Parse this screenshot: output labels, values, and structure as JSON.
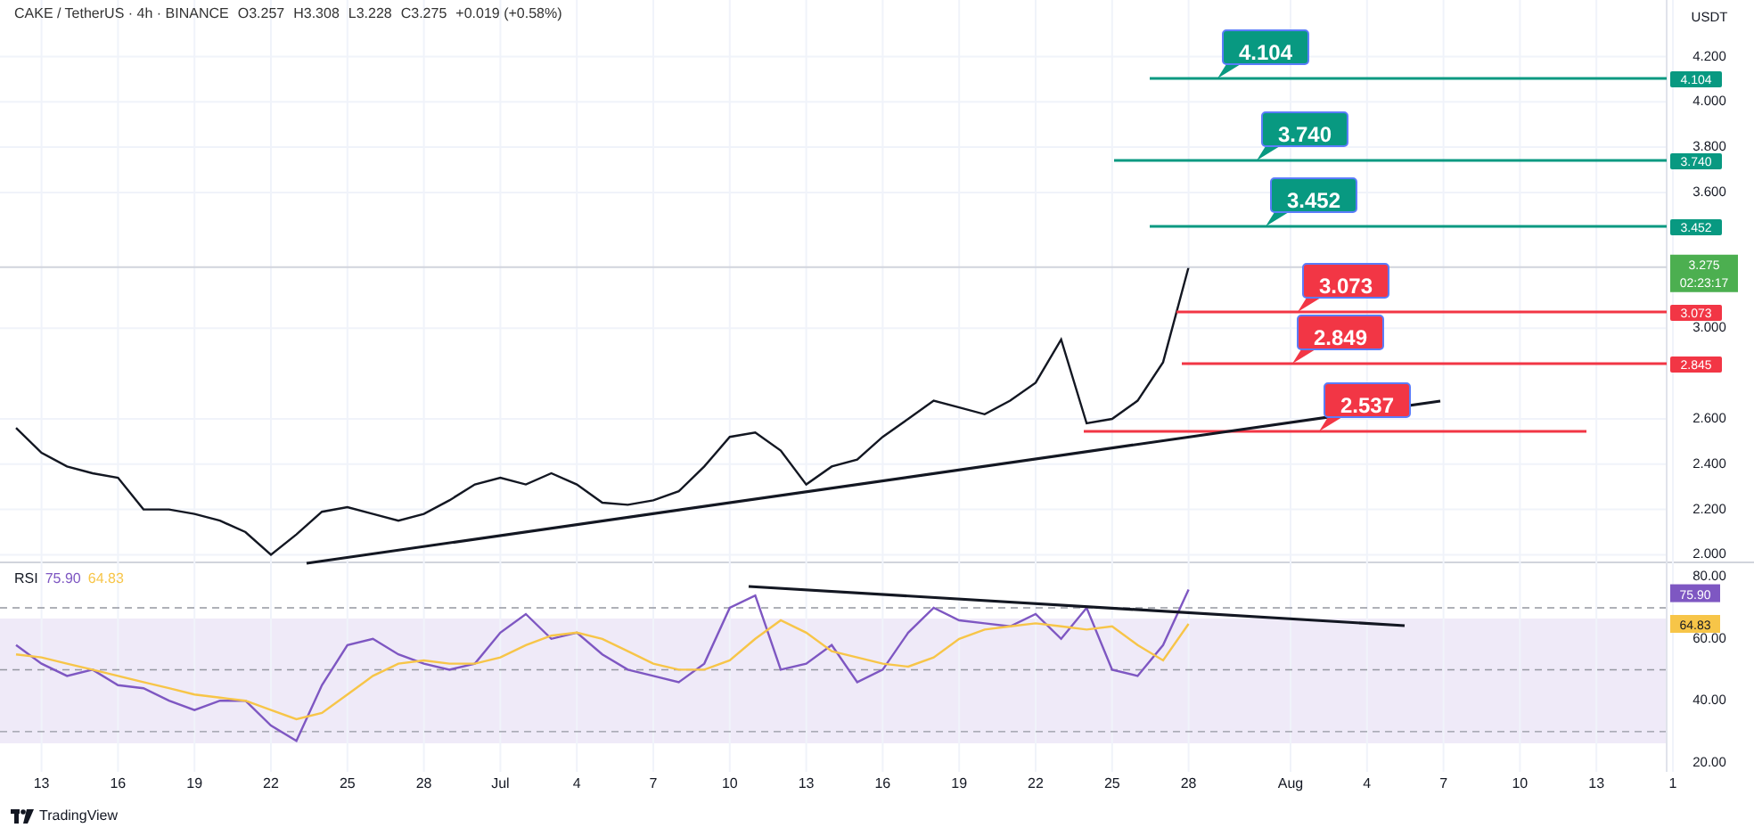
{
  "header": {
    "symbol": "CAKE / TetherUS · 4h · BINANCE",
    "ohlc": [
      "O3.257",
      "H3.308",
      "L3.228",
      "C3.275",
      "+0.019 (+0.58%)"
    ]
  },
  "price_axis": {
    "currency": "USDT",
    "last_price": "3.275",
    "countdown": "02:23:17"
  },
  "price_chart": {
    "levels": [
      {
        "kind": "resistance",
        "label": "4.104",
        "axis_label": "4.104"
      },
      {
        "kind": "resistance",
        "label": "3.740",
        "axis_label": "3.740"
      },
      {
        "kind": "resistance",
        "label": "3.452",
        "axis_label": "3.452"
      },
      {
        "kind": "support",
        "label": "3.073",
        "axis_label": "3.073"
      },
      {
        "kind": "support",
        "label": "2.849",
        "axis_label": "2.845"
      },
      {
        "kind": "support",
        "label": "2.537"
      }
    ],
    "chart_data": {
      "type": "line",
      "grid": true,
      "series": [
        {
          "color": "#131722",
          "values": [
            2.56,
            2.45,
            2.39,
            2.36,
            2.34,
            2.2,
            2.2,
            2.18,
            2.15,
            2.1,
            2.0,
            2.09,
            2.19,
            2.21,
            2.18,
            2.15,
            2.18,
            2.24,
            2.31,
            2.34,
            2.31,
            2.36,
            2.31,
            2.23,
            2.22,
            2.24,
            2.28,
            2.39,
            2.52,
            2.54,
            2.46,
            2.31,
            2.39,
            2.42,
            2.52,
            2.6,
            2.68,
            2.65,
            2.62,
            2.68,
            2.76,
            2.95,
            2.58,
            2.6,
            2.68,
            2.85,
            3.27
          ]
        }
      ],
      "yticks": [
        {
          "value": 4.2,
          "label": "4.200"
        },
        {
          "value": 4.0,
          "label": "4.000"
        },
        {
          "value": 3.8,
          "label": "3.800"
        },
        {
          "value": 3.6,
          "label": "3.600"
        },
        {
          "value": 3.0,
          "label": "3.000"
        },
        {
          "value": 2.6,
          "label": "2.600"
        },
        {
          "value": 2.4,
          "label": "2.400"
        },
        {
          "value": 2.2,
          "label": "2.200"
        },
        {
          "value": 2.0,
          "label": "2.000"
        }
      ],
      "ylim": [
        1.97,
        4.45
      ]
    }
  },
  "rsi": {
    "value": "75.90",
    "ma_value": "64.83",
    "axis_value": "75.90",
    "axis_ma_value": "64.83",
    "chart_data": {
      "type": "line",
      "grid": true,
      "series": [
        {
          "name": "RSI",
          "color": "#7e57c2",
          "values": [
            58,
            52,
            48,
            50,
            45,
            44,
            40,
            37,
            40,
            40,
            32,
            27,
            45,
            58,
            60,
            55,
            52,
            50,
            52,
            62,
            68,
            60,
            62,
            55,
            50,
            48,
            46,
            52,
            70,
            74,
            50,
            52,
            58,
            46,
            50,
            62,
            70,
            66,
            65,
            64,
            68,
            60,
            70,
            50,
            48,
            58,
            75.9
          ]
        },
        {
          "color": "#f7c548",
          "values": [
            55,
            54,
            52,
            50,
            48,
            46,
            44,
            42,
            41,
            40,
            37,
            34,
            36,
            42,
            48,
            52,
            53,
            52,
            52,
            54,
            58,
            61,
            62,
            60,
            56,
            52,
            50,
            50,
            53,
            60,
            66,
            62,
            56,
            54,
            52,
            51,
            54,
            60,
            63,
            64,
            65,
            64,
            63,
            64,
            58,
            53,
            64.83
          ]
        }
      ],
      "ylim": [
        17,
        85
      ],
      "yticks": [
        {
          "value": 80,
          "label": "80.00"
        },
        {
          "value": 60,
          "label": "60.00"
        },
        {
          "value": 40,
          "label": "40.00"
        },
        {
          "value": 20,
          "label": "20.00"
        }
      ]
    }
  },
  "date_axis": [
    "13",
    "16",
    "19",
    "22",
    "25",
    "28",
    "Jul",
    "4",
    "7",
    "10",
    "13",
    "16",
    "19",
    "22",
    "25",
    "28",
    "Aug",
    "4",
    "7",
    "10",
    "13",
    "1"
  ],
  "footer": {
    "brand": "TradingView"
  }
}
